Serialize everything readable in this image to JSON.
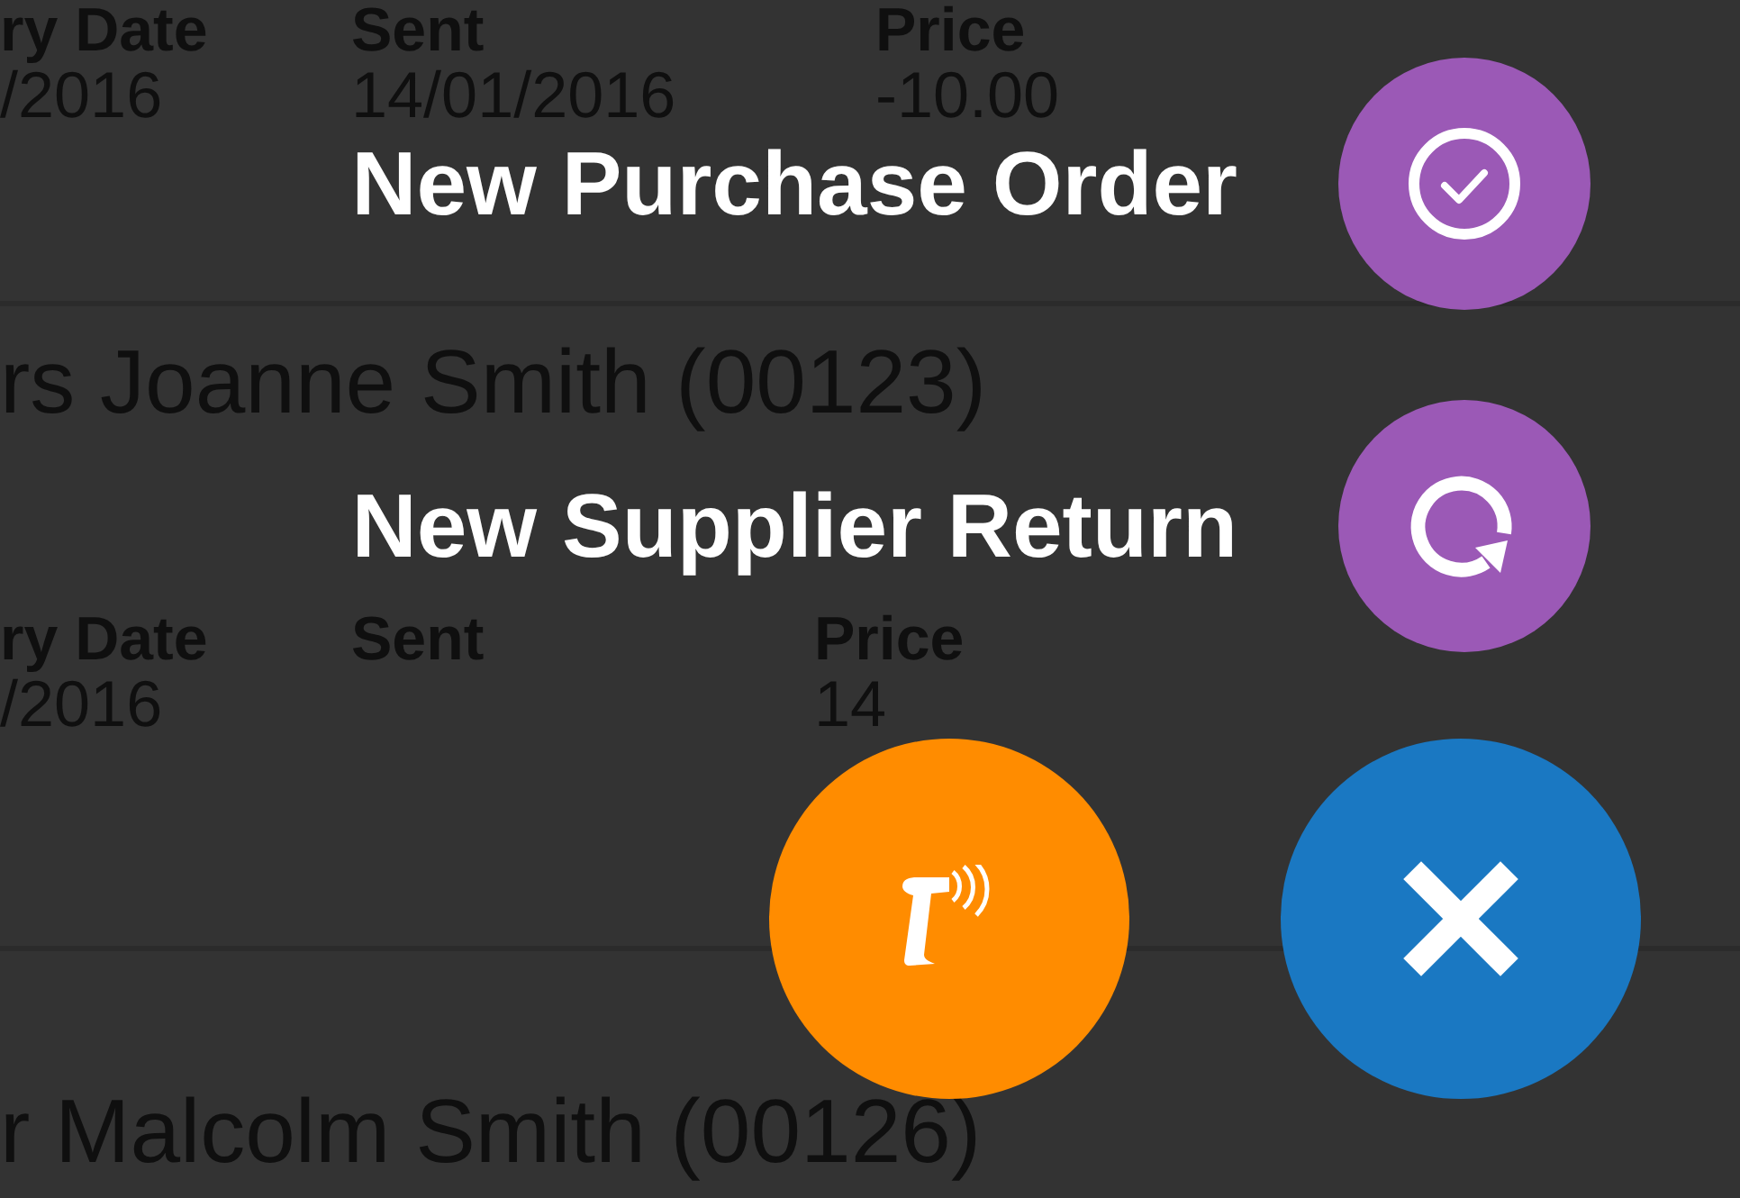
{
  "orders": [
    {
      "headers": [
        "ry Date",
        "Sent",
        "Price"
      ],
      "row": {
        "date": "/2016",
        "sent": "14/01/2016",
        "price": "-10.00"
      }
    },
    {
      "name": "rs Joanne Smith (00123)",
      "headers": [
        "ry Date",
        "Sent",
        "Price"
      ],
      "row": {
        "date": "/2016",
        "price": "14"
      }
    },
    {
      "name": "r Malcolm Smith (00126)"
    }
  ],
  "menu": [
    {
      "kind": "check",
      "label": "New Purchase Order"
    },
    {
      "kind": "refresh",
      "label": "New Supplier Return"
    }
  ],
  "actions": [
    {
      "kind": "scan"
    },
    {
      "kind": "close"
    }
  ]
}
